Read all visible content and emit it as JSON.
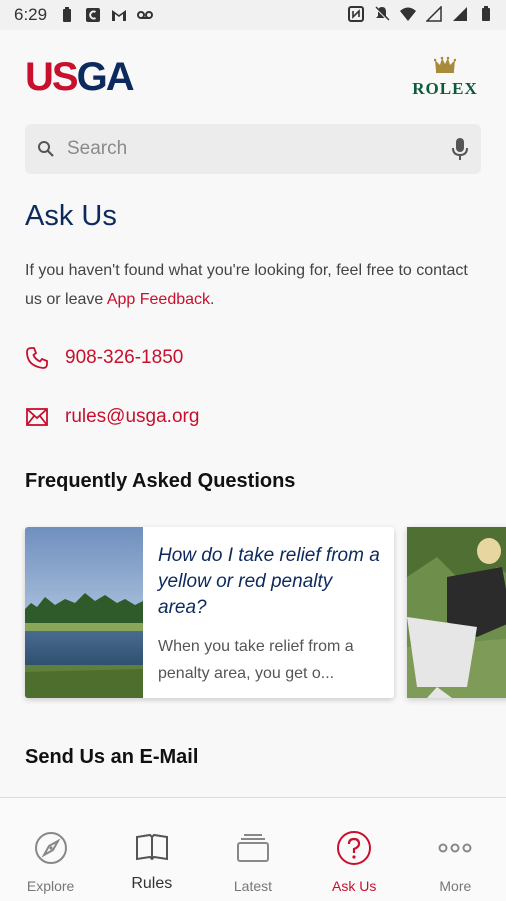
{
  "status_bar": {
    "time": "6:29"
  },
  "header": {
    "logo_us": "US",
    "logo_ga": "GA",
    "sponsor": "ROLEX"
  },
  "search": {
    "placeholder": "Search"
  },
  "page": {
    "title": "Ask Us",
    "intro_text": "If you haven't found what you're looking for, feel free to contact us or leave ",
    "intro_link": "App Feedback",
    "intro_end": ".",
    "phone": "908-326-1850",
    "email": "rules@usga.org"
  },
  "faq": {
    "title": "Frequently Asked Questions",
    "cards": [
      {
        "question": "How do I take relief from a yellow or red penalty area?",
        "answer": "When you take relief from a penalty area, you get o..."
      }
    ]
  },
  "email_section": {
    "title": "Send Us an E-Mail"
  },
  "nav": {
    "items": [
      {
        "label": "Explore",
        "icon": "compass-icon"
      },
      {
        "label": "Rules",
        "icon": "book-icon"
      },
      {
        "label": "Latest",
        "icon": "stack-icon"
      },
      {
        "label": "Ask Us",
        "icon": "question-icon"
      },
      {
        "label": "More",
        "icon": "more-icon"
      }
    ]
  },
  "colors": {
    "brand_red": "#c8102e",
    "brand_navy": "#0c2a5c"
  }
}
